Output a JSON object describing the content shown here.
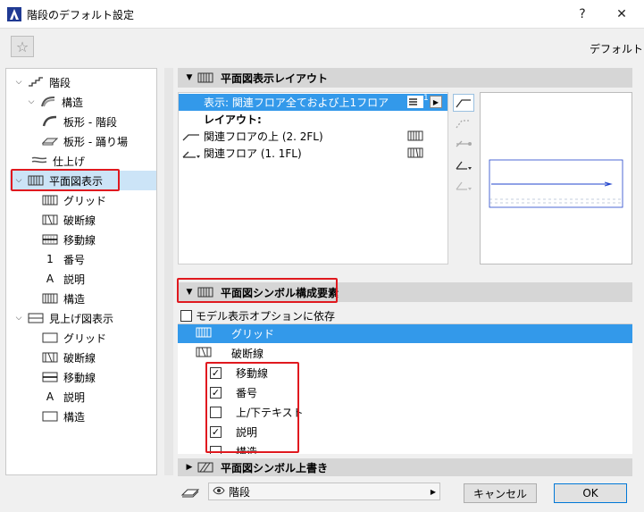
{
  "window": {
    "title": "階段のデフォルト設定",
    "help": "?",
    "close": "✕"
  },
  "toolbar": {
    "favorites_icon": "star-icon",
    "default_label": "デフォルト"
  },
  "tree": {
    "items": [
      {
        "label": "階段",
        "expanded": true
      },
      {
        "label": "構造",
        "expanded": true
      },
      {
        "label": "板形 - 階段"
      },
      {
        "label": "板形 - 踊り場"
      },
      {
        "label": "仕上げ"
      },
      {
        "label": "平面図表示",
        "expanded": true,
        "selected": true
      },
      {
        "label": "グリッド"
      },
      {
        "label": "破断線"
      },
      {
        "label": "移動線"
      },
      {
        "label": "番号"
      },
      {
        "label": "説明"
      },
      {
        "label": "構造"
      },
      {
        "label": "見上げ図表示",
        "expanded": true
      },
      {
        "label": "グリッド"
      },
      {
        "label": "破断線"
      },
      {
        "label": "移動線"
      },
      {
        "label": "説明"
      },
      {
        "label": "構造"
      }
    ],
    "glyph_number": "1",
    "glyph_text": "A"
  },
  "layout_section": {
    "title": "平面図表示レイアウト",
    "display_row": "表示: 関連フロア全ておよび上1フロア",
    "display_badge": "1",
    "layout_label": "レイアウト:",
    "rows": [
      {
        "label": "関連フロアの上 (2. 2FL)"
      },
      {
        "label": "関連フロア (1. 1FL)"
      }
    ]
  },
  "symbol_section": {
    "title": "平面図シンボル構成要素",
    "model_option_label": "モデル表示オプションに依存",
    "model_option_checked": false,
    "items": [
      {
        "label": "グリッド",
        "checkbox": false,
        "selected": true
      },
      {
        "label": "破断線",
        "checkbox": false
      },
      {
        "label": "移動線",
        "checkbox": true,
        "checked": true
      },
      {
        "label": "番号",
        "checkbox": true,
        "checked": true
      },
      {
        "label": "上/下テキスト",
        "checkbox": true,
        "checked": false
      },
      {
        "label": "説明",
        "checkbox": true,
        "checked": true
      },
      {
        "label": "構造",
        "checkbox": true,
        "checked": false
      }
    ]
  },
  "override_section": {
    "title": "平面図シンボル上書き"
  },
  "footer": {
    "layer_value": "階段",
    "cancel_label": "キャンセル",
    "ok_label": "OK"
  },
  "colors": {
    "accent": "#3399ea",
    "highlight": "#e0191f",
    "selected_tree": "#cce4f7"
  }
}
